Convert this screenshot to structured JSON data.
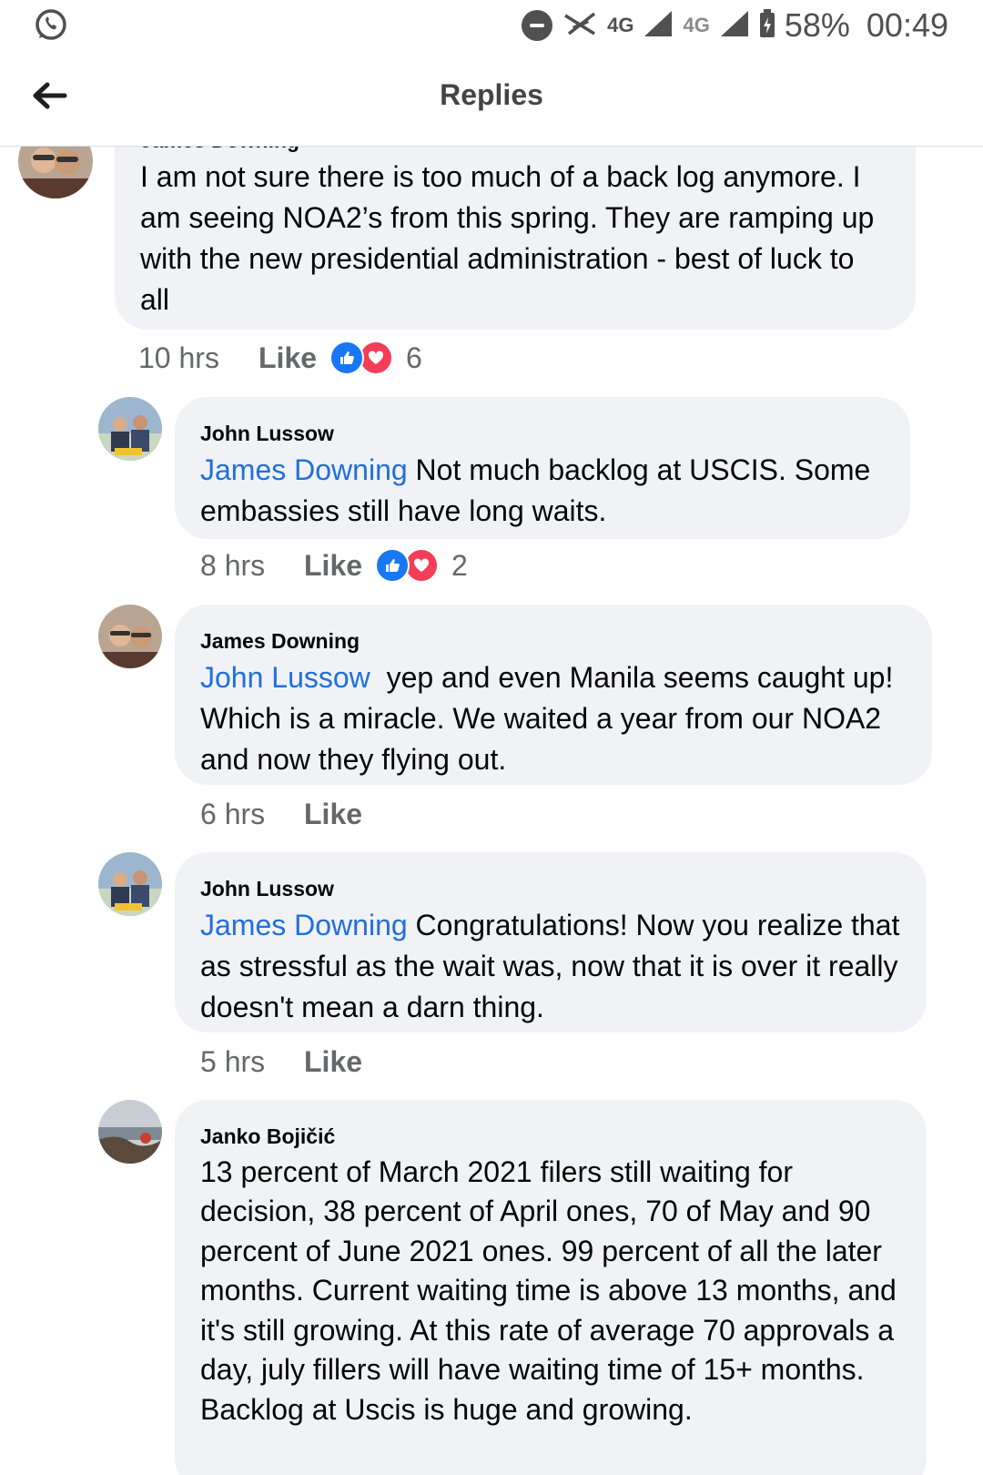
{
  "status_bar": {
    "network_1": "4G",
    "network_2": "4G",
    "battery": "58%",
    "time": "00:49"
  },
  "header": {
    "title": "Replies"
  },
  "comments": [
    {
      "author": "James Downing",
      "mention": "",
      "text": "I am not sure there is too much of a back log anymore. I am seeing NOA2’s from this spring. They are ramping up with the new presidential administration - best of luck to all",
      "time": "10 hrs",
      "like_label": "Like",
      "reaction_count": "6"
    },
    {
      "author": "John Lussow",
      "mention": "James Downing",
      "text": "Not much backlog at USCIS.  Some embassies still have long waits.",
      "time": "8 hrs",
      "like_label": "Like",
      "reaction_count": "2"
    },
    {
      "author": "James Downing",
      "mention": "John Lussow",
      "text": "yep and even Manila seems caught up! Which is a miracle. We waited a year from our NOA2 and now they flying out.",
      "time": "6 hrs",
      "like_label": "Like"
    },
    {
      "author": "John Lussow",
      "mention": "James Downing",
      "text": "Congratulations!  Now you realize that as stressful as the wait was, now that it is over it really doesn't mean a darn thing.",
      "time": "5 hrs",
      "like_label": "Like"
    },
    {
      "author": "Janko Bojičić",
      "mention": "",
      "text": "13 percent of March 2021 filers still waiting for decision, 38 percent of April ones, 70 of May and 90 percent of June 2021 ones. 99 percent of all the later months. Current waiting time is above 13 months, and it's still growing. At this rate of average 70 approvals a day, july fillers will have waiting time of 15+ months. Backlog at Uscis is huge and growing."
    }
  ],
  "colors": {
    "mention": "#216fdb",
    "bubble": "#f0f2f5",
    "like_reaction": "#1877f2",
    "love_reaction": "#f33e58"
  }
}
